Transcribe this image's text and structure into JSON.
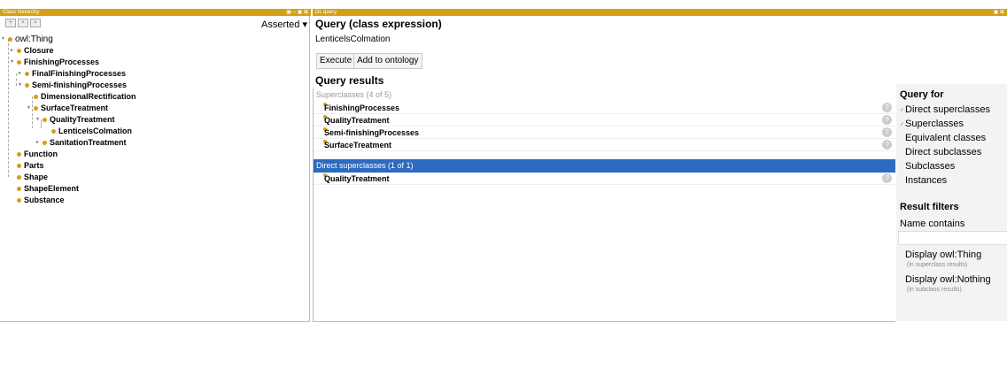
{
  "left_title": "Class hierarchy",
  "left_title_ctrls": "▣ – ▣ ⊠",
  "right_title": "DL query",
  "right_title_ctrls": "▣ ⊠",
  "asserted_label": "Asserted",
  "asserted_arrow": "▾",
  "tree": [
    {
      "label": "owl:Thing",
      "expander": "▾"
    },
    {
      "label": "Closure",
      "expander": "▸"
    },
    {
      "label": "FinishingProcesses",
      "expander": "▾"
    },
    {
      "label": "FinalFinishingProcesses",
      "expander": "▸"
    },
    {
      "label": "Semi-finishingProcesses",
      "expander": "▾"
    },
    {
      "label": "DimensionalRectification",
      "expander": ""
    },
    {
      "label": "SurfaceTreatment",
      "expander": "▾"
    },
    {
      "label": "QualityTreatment",
      "expander": "▾"
    },
    {
      "label": "LenticelsColmation",
      "expander": ""
    },
    {
      "label": "SanitationTreatment",
      "expander": "▸"
    },
    {
      "label": "Function",
      "expander": ""
    },
    {
      "label": "Parts",
      "expander": ""
    },
    {
      "label": "Shape",
      "expander": ""
    },
    {
      "label": "ShapeElement",
      "expander": ""
    },
    {
      "label": "Substance",
      "expander": ""
    }
  ],
  "query_header": "Query (class expression)",
  "query_value": "LenticelsColmation",
  "execute_label": "Execute",
  "add_label": "Add to ontology",
  "results_header": "Query results",
  "sections": [
    {
      "title": "Superclasses (4 of 5)",
      "items": [
        "FinishingProcesses",
        "QualityTreatment",
        "Semi-finishingProcesses",
        "SurfaceTreatment"
      ]
    },
    {
      "title": "Direct superclasses (1 of 1)",
      "items": [
        "QualityTreatment"
      ]
    }
  ],
  "query_icon": "?",
  "query_for_header": "Query for",
  "query_for_options": [
    {
      "label": "Direct superclasses",
      "checked": "✓"
    },
    {
      "label": "Superclasses",
      "checked": "✓"
    },
    {
      "label": "Equivalent classes",
      "checked": ""
    },
    {
      "label": "Direct subclasses",
      "checked": ""
    },
    {
      "label": "Subclasses",
      "checked": ""
    },
    {
      "label": "Instances",
      "checked": ""
    }
  ],
  "result_filters_header": "Result filters",
  "name_contains_label": "Name contains",
  "name_contains_value": "",
  "display_thing_label": "Display owl:Thing",
  "display_thing_hint": "(in superclass results)",
  "display_nothing_label": "Display owl:Nothing",
  "display_nothing_hint": "(in subclass results)",
  "colors": {
    "title_bar": "#d4a017",
    "class_dot": "#d4a017",
    "selected_section": "#2d6ac1"
  },
  "icons": {
    "class": "class-dot-icon",
    "help": "question-icon",
    "expand": "triangle-icon"
  }
}
